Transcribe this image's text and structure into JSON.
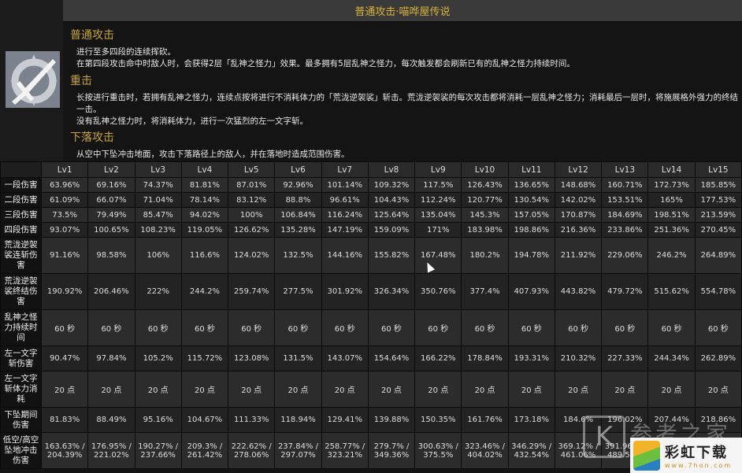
{
  "header": {
    "title": "普通攻击·喵哗屋传说"
  },
  "skill_icon": "sword-gear-icon",
  "sections": [
    {
      "title": "普通攻击",
      "lines": [
        "进行至多四段的连续挥砍。",
        "在第四段攻击命中时敌人时，会获得2层「乱神之怪力」效果。最多拥有5层乱神之怪力，每次触发都会刷新已有的乱神之怪力持续时间。"
      ]
    },
    {
      "title": "重击",
      "lines": [
        "长按进行重击时，若拥有乱神之怪力，连续点按将进行不消耗体力的「荒泷逆袈裟」斩击。荒泷逆袈裟的每次攻击都将消耗一层乱神之怪力；消耗最后一层时，将施展格外强力的终结",
        "一击。",
        "没有乱神之怪力时，将消耗体力，进行一次猛烈的左一文字斩。"
      ]
    },
    {
      "title": "下落攻击",
      "lines": [
        "从空中下坠冲击地面，攻击下落路径上的敌人，并在落地时造成范围伤害。"
      ]
    }
  ],
  "table": {
    "columns": [
      "Lv1",
      "Lv2",
      "Lv3",
      "Lv4",
      "Lv5",
      "Lv6",
      "Lv7",
      "Lv8",
      "Lv9",
      "Lv10",
      "Lv11",
      "Lv12",
      "Lv13",
      "Lv14",
      "Lv15"
    ],
    "rows": [
      {
        "label": "一段伤害",
        "values": [
          "63.96%",
          "69.16%",
          "74.37%",
          "81.81%",
          "87.01%",
          "92.96%",
          "101.14%",
          "109.32%",
          "117.5%",
          "126.43%",
          "136.65%",
          "148.68%",
          "160.71%",
          "172.73%",
          "185.85%"
        ]
      },
      {
        "label": "二段伤害",
        "values": [
          "61.09%",
          "66.07%",
          "71.04%",
          "78.14%",
          "83.12%",
          "88.8%",
          "96.61%",
          "104.43%",
          "112.24%",
          "120.77%",
          "130.54%",
          "142.02%",
          "153.51%",
          "165%",
          "177.53%"
        ]
      },
      {
        "label": "三段伤害",
        "values": [
          "73.5%",
          "79.49%",
          "85.47%",
          "94.02%",
          "100%",
          "106.84%",
          "116.24%",
          "125.64%",
          "135.04%",
          "145.3%",
          "157.05%",
          "170.87%",
          "184.69%",
          "198.51%",
          "213.59%"
        ]
      },
      {
        "label": "四段伤害",
        "values": [
          "93.07%",
          "100.65%",
          "108.23%",
          "119.05%",
          "126.62%",
          "135.28%",
          "147.19%",
          "159.09%",
          "171%",
          "183.98%",
          "198.86%",
          "216.36%",
          "233.86%",
          "251.36%",
          "270.45%"
        ]
      },
      {
        "label": "荒泷逆袈裟连斩伤害",
        "values": [
          "91.16%",
          "98.58%",
          "106%",
          "116.6%",
          "124.02%",
          "132.5%",
          "144.16%",
          "155.82%",
          "167.48%",
          "180.2%",
          "194.78%",
          "211.92%",
          "229.06%",
          "246.2%",
          "264.89%"
        ]
      },
      {
        "label": "荒泷逆袈裟终结伤害",
        "values": [
          "190.92%",
          "206.46%",
          "222%",
          "244.2%",
          "259.74%",
          "277.5%",
          "301.92%",
          "326.34%",
          "350.76%",
          "377.4%",
          "407.93%",
          "443.82%",
          "479.72%",
          "515.62%",
          "554.78%"
        ]
      },
      {
        "label": "乱神之怪力持续时间",
        "values": [
          "60 秒",
          "60 秒",
          "60 秒",
          "60 秒",
          "60 秒",
          "60 秒",
          "60 秒",
          "60 秒",
          "60 秒",
          "60 秒",
          "60 秒",
          "60 秒",
          "60 秒",
          "60 秒",
          "60 秒"
        ]
      },
      {
        "label": "左一文字斩伤害",
        "values": [
          "90.47%",
          "97.84%",
          "105.2%",
          "115.72%",
          "123.08%",
          "131.5%",
          "143.07%",
          "154.64%",
          "166.22%",
          "178.84%",
          "193.31%",
          "210.32%",
          "227.33%",
          "244.34%",
          "262.89%"
        ]
      },
      {
        "label": "左一文字斩体力消耗",
        "values": [
          "20 点",
          "20 点",
          "20 点",
          "20 点",
          "20 点",
          "20 点",
          "20 点",
          "20 点",
          "20 点",
          "20 点",
          "20 点",
          "20 点",
          "20 点",
          "20 点",
          "20 点"
        ]
      },
      {
        "label": "下坠期间伤害",
        "values": [
          "81.83%",
          "88.49%",
          "95.16%",
          "104.67%",
          "111.33%",
          "118.94%",
          "129.41%",
          "139.88%",
          "150.35%",
          "161.76%",
          "173.18%",
          "184.6%",
          "196.02%",
          "207.44%",
          "218.86%"
        ]
      },
      {
        "label": "低空/高空坠地冲击伤害",
        "values": [
          "163.63% / 204.39%",
          "176.95% / 221.02%",
          "190.27% / 237.66%",
          "209.3% / 261.42%",
          "222.62% / 278.06%",
          "237.84% / 297.07%",
          "258.77% / 323.21%",
          "279.7% / 349.36%",
          "300.63% / 375.5%",
          "323.46% / 404.02%",
          "346.29% / 432.54%",
          "369.12% / 461.06%",
          "391.96% / 489.57%",
          "",
          ""
        ]
      }
    ]
  },
  "watermarks": {
    "wm1_letter": "K",
    "wm1_text": "参考之家",
    "wm2_title": "彩虹下载",
    "wm2_url": "www.7hon.com"
  }
}
